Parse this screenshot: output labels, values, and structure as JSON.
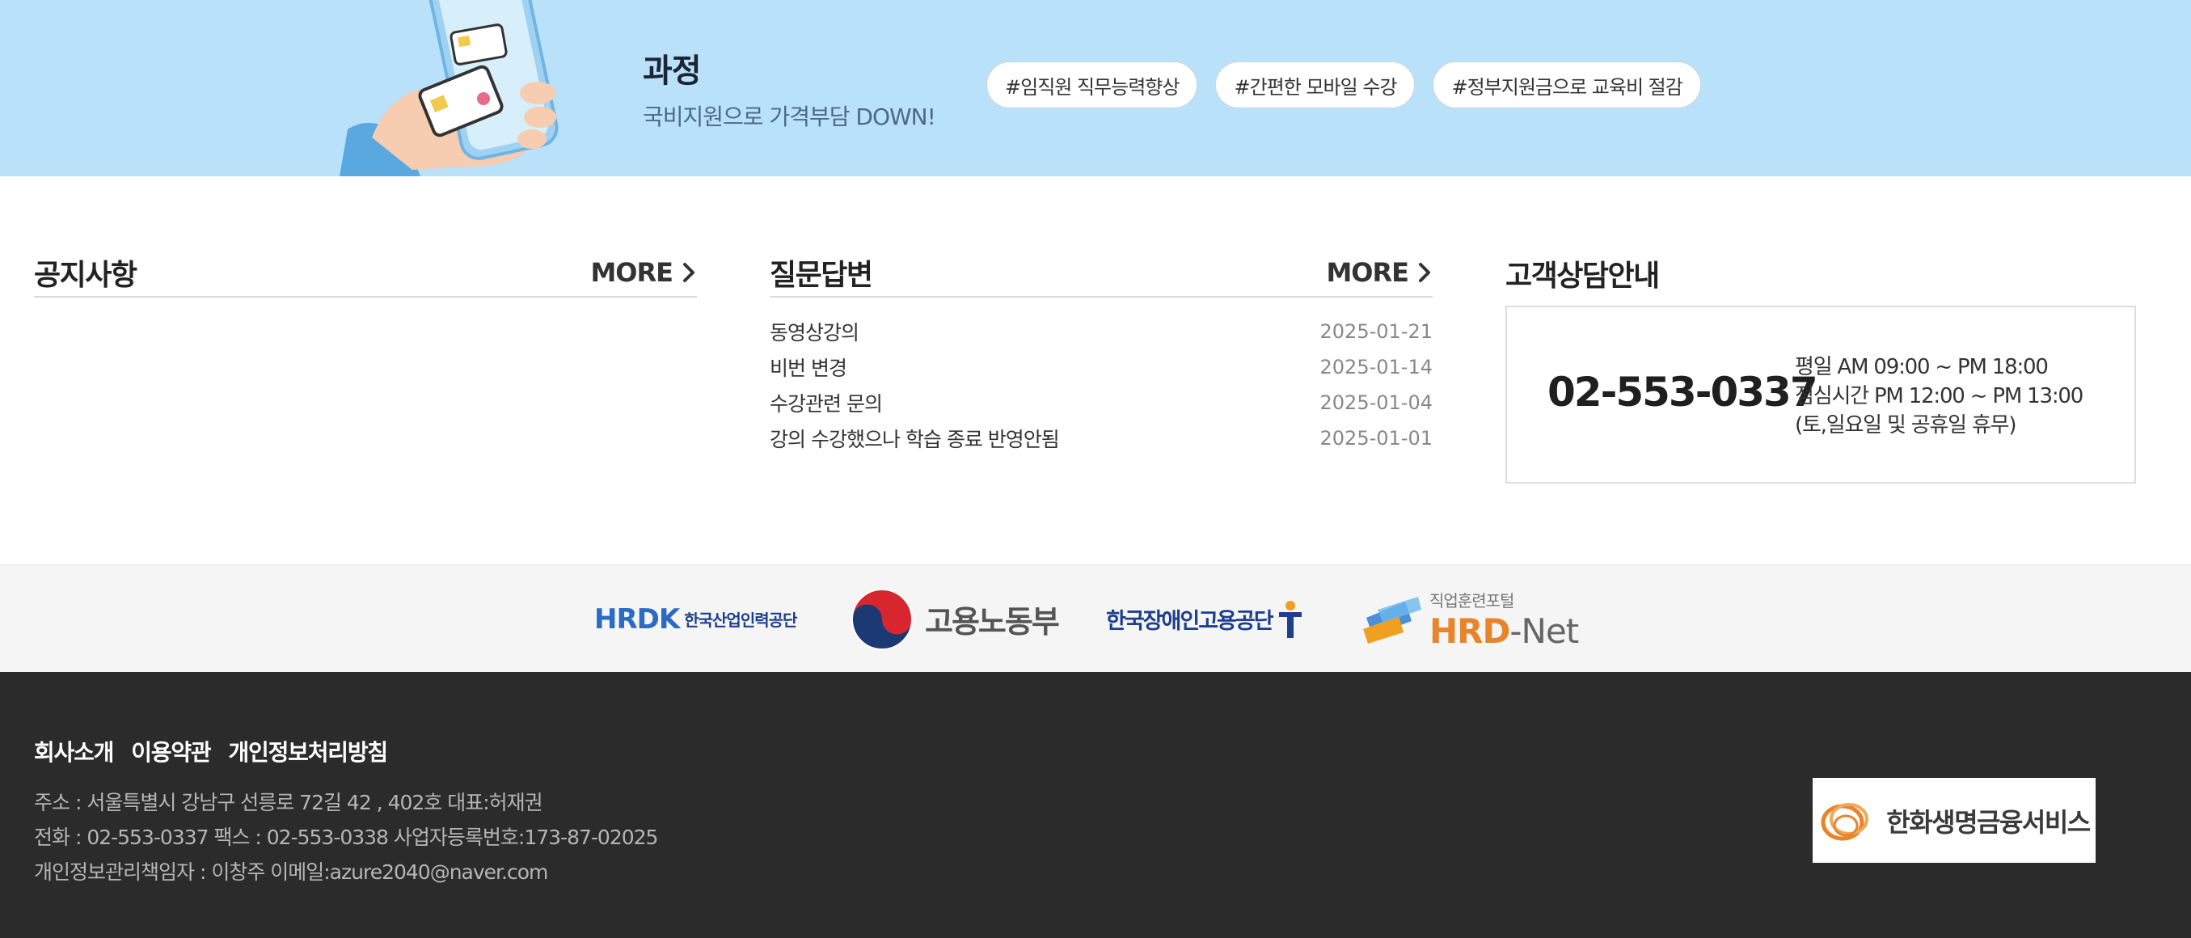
{
  "banner": {
    "title": "과정",
    "subtitle": "국비지원으로 가격부담 DOWN!",
    "tags": [
      "#임직원 직무능력향상",
      "#간편한 모바일 수강",
      "#정부지원금으로 교육비 절감"
    ]
  },
  "notice": {
    "title": "공지사항",
    "more_label": "MORE"
  },
  "qa": {
    "title": "질문답변",
    "more_label": "MORE",
    "items": [
      {
        "title": "동영상강의",
        "date": "2025-01-21"
      },
      {
        "title": "비번 변경",
        "date": "2025-01-14"
      },
      {
        "title": "수강관련 문의",
        "date": "2025-01-04"
      },
      {
        "title": "강의 수강했으나 학습 종료 반영안됨",
        "date": "2025-01-01"
      }
    ]
  },
  "customer": {
    "title": "고객상담안내",
    "phone": "02-553-0337",
    "hours": [
      "평일 AM 09:00 ~ PM 18:00",
      "점심시간 PM 12:00 ~ PM 13:00",
      "(토,일요일 및 공휴일 휴무)"
    ]
  },
  "partners": {
    "hrdk_mark": "HRDK",
    "hrdk_name": "한국산업인력공단",
    "moel_name": "고용노동부",
    "kead_name": "한국장애인고용공단",
    "hrdnet_top": "직업훈련포털",
    "hrdnet_hrd": "HRD",
    "hrdnet_net": "-Net"
  },
  "footer": {
    "links": [
      "회사소개",
      "이용약관",
      "개인정보처리방침"
    ],
    "address": "주소 : 서울특별시 강남구 선릉로 72길 42 , 402호 대표:허재권",
    "contact": "전화 : 02-553-0337 팩스 : 02-553-0338 사업자등록번호:173-87-02025",
    "privacy": "개인정보관리책임자 : 이창주 이메일:azure2040@naver.com",
    "company_logo": "한화생명금융서비스"
  },
  "colors": {
    "banner_bg": "#b9e1f9",
    "footer_bg": "#2b2b2b",
    "partner_bg": "#f5f5f5",
    "hrd_orange": "#e8842a",
    "hrdk_blue": "#2a6bc4"
  }
}
